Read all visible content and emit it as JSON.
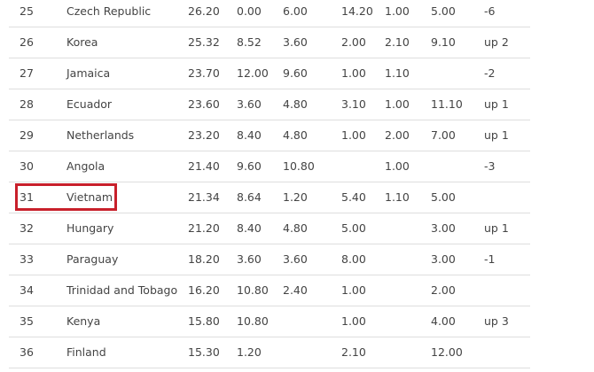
{
  "highlight_color": "#c8202b",
  "rows": [
    {
      "rank": "25",
      "team": "Czech Republic",
      "total": "26.20",
      "m1": "0.00",
      "m2": "6.00",
      "m3": "14.20",
      "m4": "1.00",
      "m5": "5.00",
      "change": "-6"
    },
    {
      "rank": "26",
      "team": "Korea",
      "total": "25.32",
      "m1": "8.52",
      "m2": "3.60",
      "m3": "2.00",
      "m4": "2.10",
      "m5": "9.10",
      "change": "up 2"
    },
    {
      "rank": "27",
      "team": "Jamaica",
      "total": "23.70",
      "m1": "12.00",
      "m2": "9.60",
      "m3": "1.00",
      "m4": "1.10",
      "m5": "",
      "change": "-2"
    },
    {
      "rank": "28",
      "team": "Ecuador",
      "total": "23.60",
      "m1": "3.60",
      "m2": "4.80",
      "m3": "3.10",
      "m4": "1.00",
      "m5": "11.10",
      "change": "up 1"
    },
    {
      "rank": "29",
      "team": "Netherlands",
      "total": "23.20",
      "m1": "8.40",
      "m2": "4.80",
      "m3": "1.00",
      "m4": "2.00",
      "m5": "7.00",
      "change": "up 1"
    },
    {
      "rank": "30",
      "team": "Angola",
      "total": "21.40",
      "m1": "9.60",
      "m2": "10.80",
      "m3": "",
      "m4": "1.00",
      "m5": "",
      "change": "-3"
    },
    {
      "rank": "31",
      "team": "Vietnam",
      "total": "21.34",
      "m1": "8.64",
      "m2": "1.20",
      "m3": "5.40",
      "m4": "1.10",
      "m5": "5.00",
      "change": ""
    },
    {
      "rank": "32",
      "team": "Hungary",
      "total": "21.20",
      "m1": "8.40",
      "m2": "4.80",
      "m3": "5.00",
      "m4": "",
      "m5": "3.00",
      "change": "up 1"
    },
    {
      "rank": "33",
      "team": "Paraguay",
      "total": "18.20",
      "m1": "3.60",
      "m2": "3.60",
      "m3": "8.00",
      "m4": "",
      "m5": "3.00",
      "change": "-1"
    },
    {
      "rank": "34",
      "team": "Trinidad and Tobago",
      "total": "16.20",
      "m1": "10.80",
      "m2": "2.40",
      "m3": "1.00",
      "m4": "",
      "m5": "2.00",
      "change": ""
    },
    {
      "rank": "35",
      "team": "Kenya",
      "total": "15.80",
      "m1": "10.80",
      "m2": "",
      "m3": "1.00",
      "m4": "",
      "m5": "4.00",
      "change": "up 3"
    },
    {
      "rank": "36",
      "team": "Finland",
      "total": "15.30",
      "m1": "1.20",
      "m2": "",
      "m3": "2.10",
      "m4": "",
      "m5": "12.00",
      "change": ""
    }
  ]
}
